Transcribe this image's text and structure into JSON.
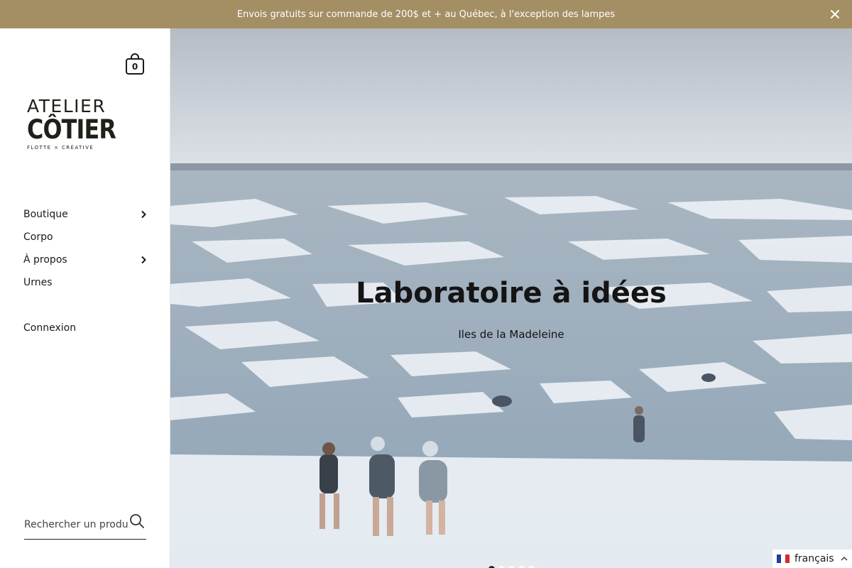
{
  "announcement": {
    "text": "Envois gratuits sur commande de 200$ et + au Québec, à l'exception des lampes",
    "background": "#a48e64",
    "close_icon": "close-icon"
  },
  "cart": {
    "count": "0",
    "icon": "shopping-bag-icon"
  },
  "logo": {
    "line1": "ATELIER",
    "line2": "CÔTIER",
    "line3": "FLOTTE × CRÉATIVE"
  },
  "nav": {
    "items": [
      {
        "label": "Boutique",
        "has_submenu": true
      },
      {
        "label": "Corpo",
        "has_submenu": false
      },
      {
        "label": "À propos",
        "has_submenu": true
      },
      {
        "label": "Urnes",
        "has_submenu": false
      }
    ],
    "login": "Connexion"
  },
  "search": {
    "placeholder": "Rechercher un produit",
    "icon": "search-icon"
  },
  "hero": {
    "title": "Laboratoire à idées",
    "subtitle": "Iles de la Madeleine",
    "slides": 5,
    "active_slide": 1
  },
  "language": {
    "label": "français",
    "flag": "france-flag-icon",
    "chevron": "chevron-up-icon"
  }
}
